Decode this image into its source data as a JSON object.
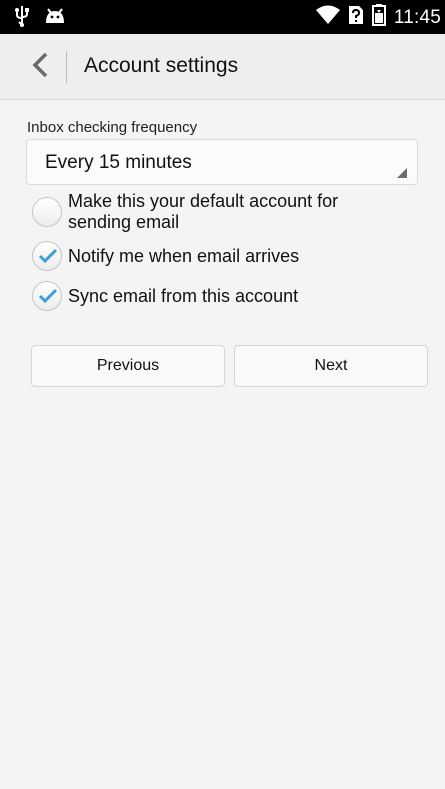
{
  "status_bar": {
    "time": "11:45",
    "icons": [
      "usb-icon",
      "android-icon",
      "wifi-icon",
      "sim-unknown-icon",
      "battery-icon"
    ]
  },
  "action_bar": {
    "title": "Account settings",
    "back_icon": "chevron-left-icon"
  },
  "settings": {
    "frequency_label": "Inbox checking frequency",
    "frequency_value": "Every 15 minutes",
    "options": [
      {
        "label": "Make this your default account for sending email",
        "checked": false
      },
      {
        "label": "Notify me when email arrives",
        "checked": true
      },
      {
        "label": "Sync email from this account",
        "checked": true
      }
    ]
  },
  "buttons": {
    "previous": "Previous",
    "next": "Next"
  },
  "colors": {
    "accent": "#3aa0dc",
    "status_bar": "#000000",
    "action_bar": "#eeeeee",
    "background": "#f4f4f4"
  }
}
